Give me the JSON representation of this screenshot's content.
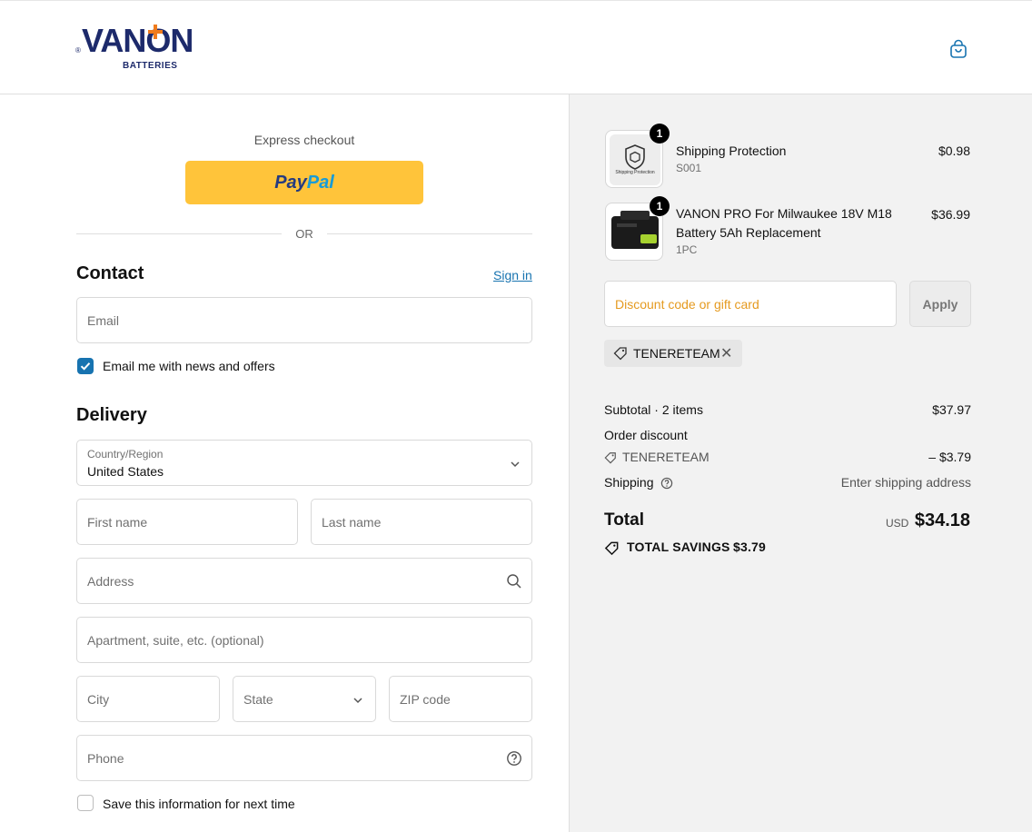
{
  "brand": {
    "logo_text": "VANON",
    "logo_sub": "BATTERIES",
    "logo_reg": "®"
  },
  "express": {
    "label": "Express checkout",
    "paypal_1": "Pay",
    "paypal_2": "Pal",
    "or": "OR"
  },
  "contact": {
    "heading": "Contact",
    "signin": "Sign in",
    "email_placeholder": "Email",
    "news_label": "Email me with news and offers",
    "news_checked": true
  },
  "delivery": {
    "heading": "Delivery",
    "country_label": "Country/Region",
    "country_value": "United States",
    "first_name": "First name",
    "last_name": "Last name",
    "address": "Address",
    "apartment": "Apartment, suite, etc. (optional)",
    "city": "City",
    "state": "State",
    "zip": "ZIP code",
    "phone": "Phone",
    "save_label": "Save this information for next time",
    "save_checked": false
  },
  "cart": {
    "items": [
      {
        "name": "Shipping Protection",
        "sub": "S001",
        "price": "$0.98",
        "qty": "1",
        "thumb_label": "Shipping Protection"
      },
      {
        "name_1": "VANON PRO For Milwaukee 18V M18",
        "name_2": "Battery 5Ah Replacement",
        "sub": "1PC",
        "price": "$36.99",
        "qty": "1"
      }
    ],
    "discount_placeholder": "Discount code or gift card",
    "apply_label": "Apply",
    "applied_code": "TENERETEAM"
  },
  "summary": {
    "subtotal_label": "Subtotal · 2 items",
    "subtotal_value": "$37.97",
    "order_discount_label": "Order discount",
    "discount_code": "TENERETEAM",
    "discount_value": "– $3.79",
    "shipping_label": "Shipping",
    "shipping_value": "Enter shipping address",
    "total_label": "Total",
    "currency": "USD",
    "total_value": "$34.18",
    "savings_label": "TOTAL SAVINGS",
    "savings_value": "$3.79"
  },
  "colors": {
    "accent": "#1773b0",
    "paypal": "#ffc43a",
    "brand_navy": "#1d2a6b",
    "brand_orange": "#f07b1c",
    "sidebar_bg": "#f2f2f2"
  }
}
